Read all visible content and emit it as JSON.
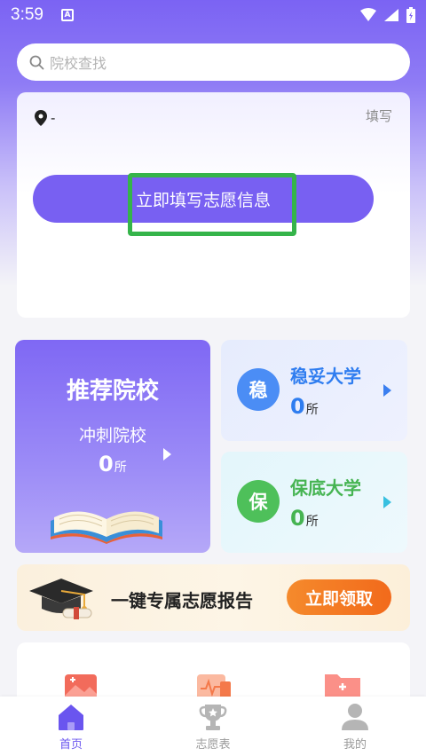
{
  "status_bar": {
    "time": "3:59",
    "notification_badge": "A"
  },
  "search": {
    "placeholder": "院校查找"
  },
  "info_card": {
    "location": "-",
    "fill_link": "填写",
    "cta_label": "立即填写志愿信息"
  },
  "recommend": {
    "title": "推荐院校",
    "subtitle": "冲刺院校",
    "count": "0",
    "unit": "所"
  },
  "stable": {
    "badge": "稳",
    "title": "稳妥大学",
    "count": "0",
    "unit": "所"
  },
  "safe": {
    "badge": "保",
    "title": "保底大学",
    "count": "0",
    "unit": "所"
  },
  "report": {
    "text": "一键专属志愿报告",
    "button": "立即领取"
  },
  "bottom_nav": {
    "items": [
      {
        "label": "首页",
        "icon": "home-icon",
        "active": true
      },
      {
        "label": "志愿表",
        "icon": "trophy-icon",
        "active": false
      },
      {
        "label": "我的",
        "icon": "user-icon",
        "active": false
      }
    ]
  },
  "colors": {
    "primary": "#7860f2",
    "stable_blue": "#2f7df0",
    "safe_green": "#46b452",
    "claim_orange": "#f26a1b",
    "highlight_green": "#35b44a"
  }
}
